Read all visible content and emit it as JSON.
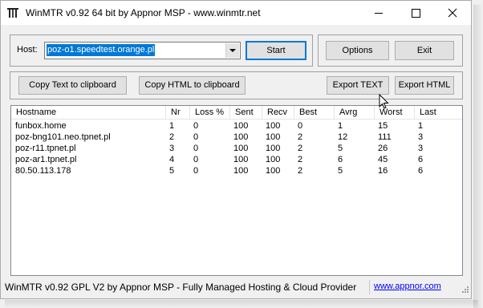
{
  "window": {
    "title": "WinMTR v0.92 64 bit by Appnor MSP - www.winmtr.net",
    "minimize_icon": "minimize-icon",
    "maximize_icon": "maximize-icon",
    "close_icon": "close-icon"
  },
  "host": {
    "label": "Host:",
    "value": "poz-o1.speedtest.orange.pl"
  },
  "buttons": {
    "start": "Start",
    "options": "Options",
    "exit": "Exit",
    "copy_text": "Copy Text to clipboard",
    "copy_html": "Copy HTML to clipboard",
    "export_text": "Export TEXT",
    "export_html": "Export HTML"
  },
  "table": {
    "columns": [
      "Hostname",
      "Nr",
      "Loss %",
      "Sent",
      "Recv",
      "Best",
      "Avrg",
      "Worst",
      "Last"
    ],
    "rows": [
      [
        "funbox.home",
        "1",
        "0",
        "100",
        "100",
        "0",
        "1",
        "15",
        "1"
      ],
      [
        "poz-bng101.neo.tpnet.pl",
        "2",
        "0",
        "100",
        "100",
        "2",
        "12",
        "111",
        "3"
      ],
      [
        "poz-r11.tpnet.pl",
        "3",
        "0",
        "100",
        "100",
        "2",
        "5",
        "26",
        "3"
      ],
      [
        "poz-ar1.tpnet.pl",
        "4",
        "0",
        "100",
        "100",
        "2",
        "6",
        "45",
        "6"
      ],
      [
        "80.50.113.178",
        "5",
        "0",
        "100",
        "100",
        "2",
        "5",
        "16",
        "6"
      ]
    ]
  },
  "status": {
    "text": "WinMTR v0.92 GPL V2 by Appnor MSP - Fully Managed Hosting & Cloud Provider",
    "link": "www.appnor.com"
  },
  "colors": {
    "selection": "#0078d7",
    "link": "#0000ff",
    "default_button_border": "#0078d7"
  }
}
